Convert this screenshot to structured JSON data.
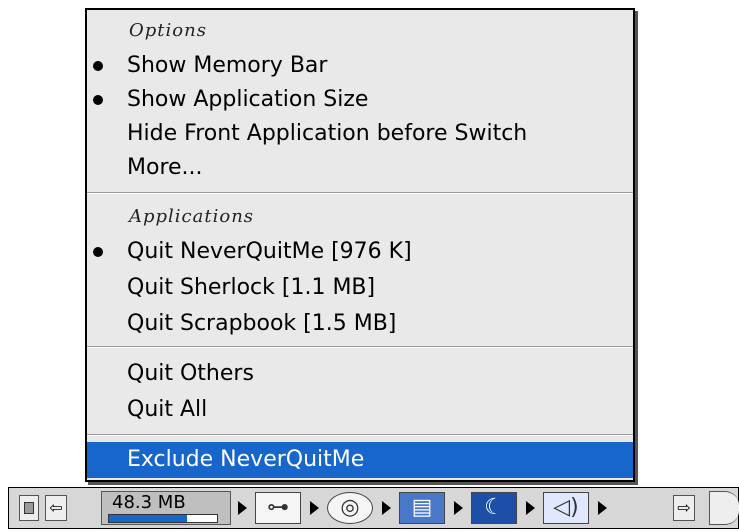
{
  "menu": {
    "options_title": "Options",
    "options": [
      {
        "label": "Show Memory Bar",
        "checked": true
      },
      {
        "label": "Show Application Size",
        "checked": true
      },
      {
        "label": "Hide Front Application before Switch",
        "checked": false
      },
      {
        "label": "More...",
        "checked": false
      }
    ],
    "applications_title": "Applications",
    "applications": [
      {
        "label": "Quit NeverQuitMe [976 K]",
        "checked": true
      },
      {
        "label": "Quit Sherlock [1.1 MB]",
        "checked": false
      },
      {
        "label": "Quit Scrapbook [1.5 MB]",
        "checked": false
      }
    ],
    "quit_others": "Quit Others",
    "quit_all": "Quit All",
    "exclude": "Exclude NeverQuitMe",
    "selected_color": "#1666cc"
  },
  "control_strip": {
    "memory_text": "48.3 MB",
    "memory_used_fraction": 0.72,
    "modules": [
      {
        "icon": "appletalk-icon"
      },
      {
        "icon": "cd-icon"
      },
      {
        "icon": "file-sharing-icon"
      },
      {
        "icon": "monitor-icon"
      },
      {
        "icon": "sound-icon"
      }
    ]
  }
}
